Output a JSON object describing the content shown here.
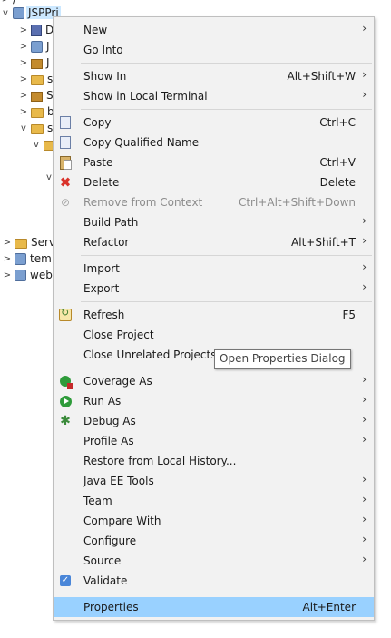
{
  "tree": {
    "top_partial": "/",
    "project_label": "JSPPri",
    "children_partial": [
      "D",
      "J",
      "J",
      "s",
      "S",
      "b",
      "s"
    ],
    "siblings": [
      "Serv",
      "tem",
      "web"
    ]
  },
  "menu": {
    "items": [
      {
        "label": "New",
        "shortcut": "",
        "submenu": true,
        "icon": ""
      },
      {
        "label": "Go Into",
        "shortcut": "",
        "submenu": false,
        "icon": ""
      },
      {
        "sep": true
      },
      {
        "label": "Show In",
        "shortcut": "Alt+Shift+W",
        "submenu": true,
        "icon": ""
      },
      {
        "label": "Show in Local Terminal",
        "shortcut": "",
        "submenu": true,
        "icon": ""
      },
      {
        "sep": true
      },
      {
        "label": "Copy",
        "shortcut": "Ctrl+C",
        "submenu": false,
        "icon": "copy-icon"
      },
      {
        "label": "Copy Qualified Name",
        "shortcut": "",
        "submenu": false,
        "icon": "copy-qualified-icon"
      },
      {
        "label": "Paste",
        "shortcut": "Ctrl+V",
        "submenu": false,
        "icon": "paste-icon"
      },
      {
        "label": "Delete",
        "shortcut": "Delete",
        "submenu": false,
        "icon": "delete-icon"
      },
      {
        "label": "Remove from Context",
        "shortcut": "Ctrl+Alt+Shift+Down",
        "submenu": false,
        "icon": "remove-context-icon",
        "disabled": true
      },
      {
        "label": "Build Path",
        "shortcut": "",
        "submenu": true,
        "icon": ""
      },
      {
        "label": "Refactor",
        "shortcut": "Alt+Shift+T",
        "submenu": true,
        "icon": ""
      },
      {
        "sep": true
      },
      {
        "label": "Import",
        "shortcut": "",
        "submenu": true,
        "icon": ""
      },
      {
        "label": "Export",
        "shortcut": "",
        "submenu": true,
        "icon": ""
      },
      {
        "sep": true
      },
      {
        "label": "Refresh",
        "shortcut": "F5",
        "submenu": false,
        "icon": "refresh-icon"
      },
      {
        "label": "Close Project",
        "shortcut": "",
        "submenu": false,
        "icon": ""
      },
      {
        "label": "Close Unrelated Projects",
        "shortcut": "",
        "submenu": false,
        "icon": ""
      },
      {
        "sep": true
      },
      {
        "label": "Coverage As",
        "shortcut": "",
        "submenu": true,
        "icon": "coverage-icon"
      },
      {
        "label": "Run As",
        "shortcut": "",
        "submenu": true,
        "icon": "run-icon"
      },
      {
        "label": "Debug As",
        "shortcut": "",
        "submenu": true,
        "icon": "debug-icon"
      },
      {
        "label": "Profile As",
        "shortcut": "",
        "submenu": true,
        "icon": ""
      },
      {
        "label": "Restore from Local History...",
        "shortcut": "",
        "submenu": false,
        "icon": ""
      },
      {
        "label": "Java EE Tools",
        "shortcut": "",
        "submenu": true,
        "icon": ""
      },
      {
        "label": "Team",
        "shortcut": "",
        "submenu": true,
        "icon": ""
      },
      {
        "label": "Compare With",
        "shortcut": "",
        "submenu": true,
        "icon": ""
      },
      {
        "label": "Configure",
        "shortcut": "",
        "submenu": true,
        "icon": ""
      },
      {
        "label": "Source",
        "shortcut": "",
        "submenu": true,
        "icon": ""
      },
      {
        "label": "Validate",
        "shortcut": "",
        "submenu": false,
        "icon": "validate-icon"
      },
      {
        "sep": true
      },
      {
        "label": "Properties",
        "shortcut": "Alt+Enter",
        "submenu": false,
        "icon": "",
        "selected": true
      }
    ]
  },
  "tooltip": "Open Properties Dialog",
  "colors": {
    "selected_bg": "#99d1ff",
    "menu_bg": "#f2f2f2",
    "delete_red": "#d9332b",
    "run_green": "#2e9b3a"
  }
}
